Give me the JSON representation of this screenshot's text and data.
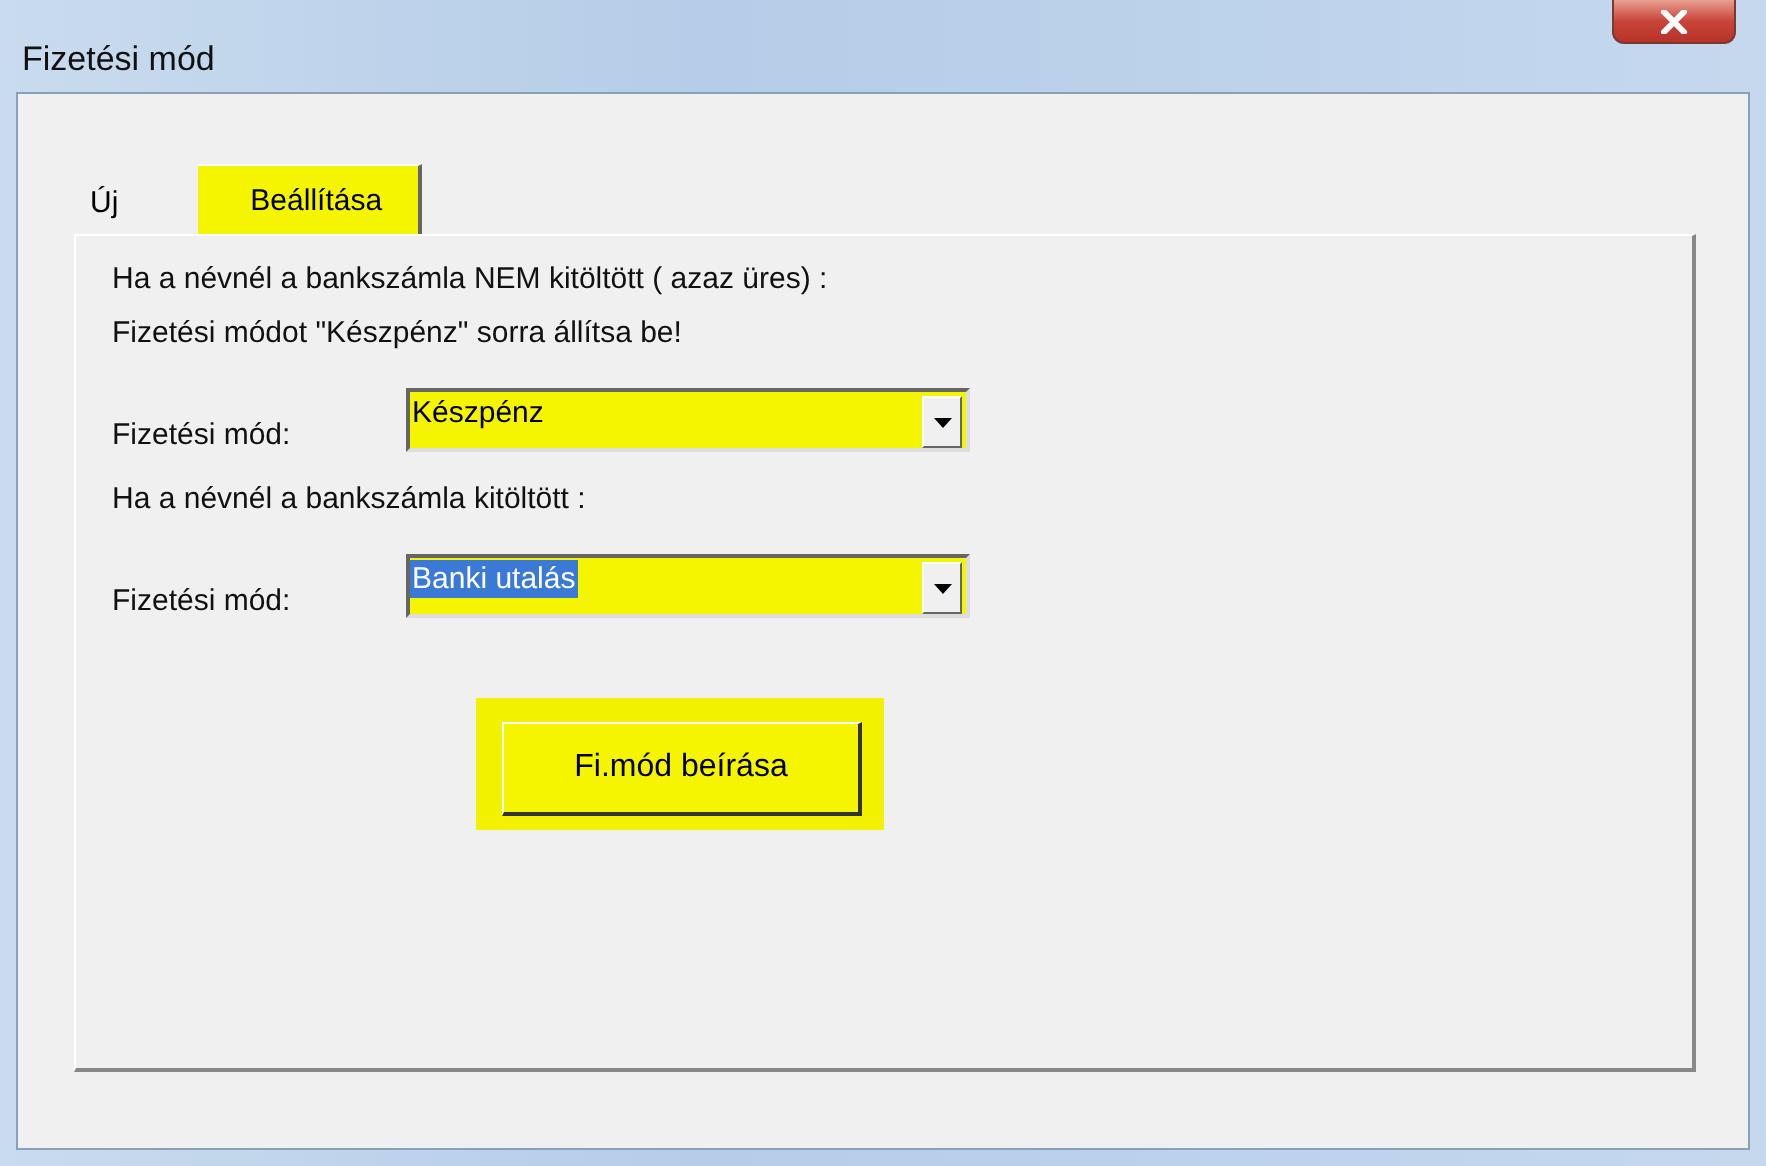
{
  "window": {
    "title": "Fizetési mód"
  },
  "tabs": [
    {
      "label": "Új",
      "selected": false
    },
    {
      "label": "Beállítása",
      "selected": true
    }
  ],
  "panel": {
    "items": [
      {
        "kind": "text",
        "text": "Ha a névnél a bankszámla  NEM kitöltött ( azaz üres) :"
      },
      {
        "kind": "text",
        "text": "Fizetési módot \"Készpénz\" sorra állítsa be!"
      },
      {
        "kind": "combo",
        "label": "Fizetési mód:",
        "value": "Készpénz",
        "text_selected": false
      },
      {
        "kind": "text",
        "text": "Ha a névnél a bankszámla   kitöltött :"
      },
      {
        "kind": "combo",
        "label": "Fizetési mód:",
        "value": "Banki utalás",
        "text_selected": true
      }
    ],
    "button": "Fi.mód beírása"
  }
}
